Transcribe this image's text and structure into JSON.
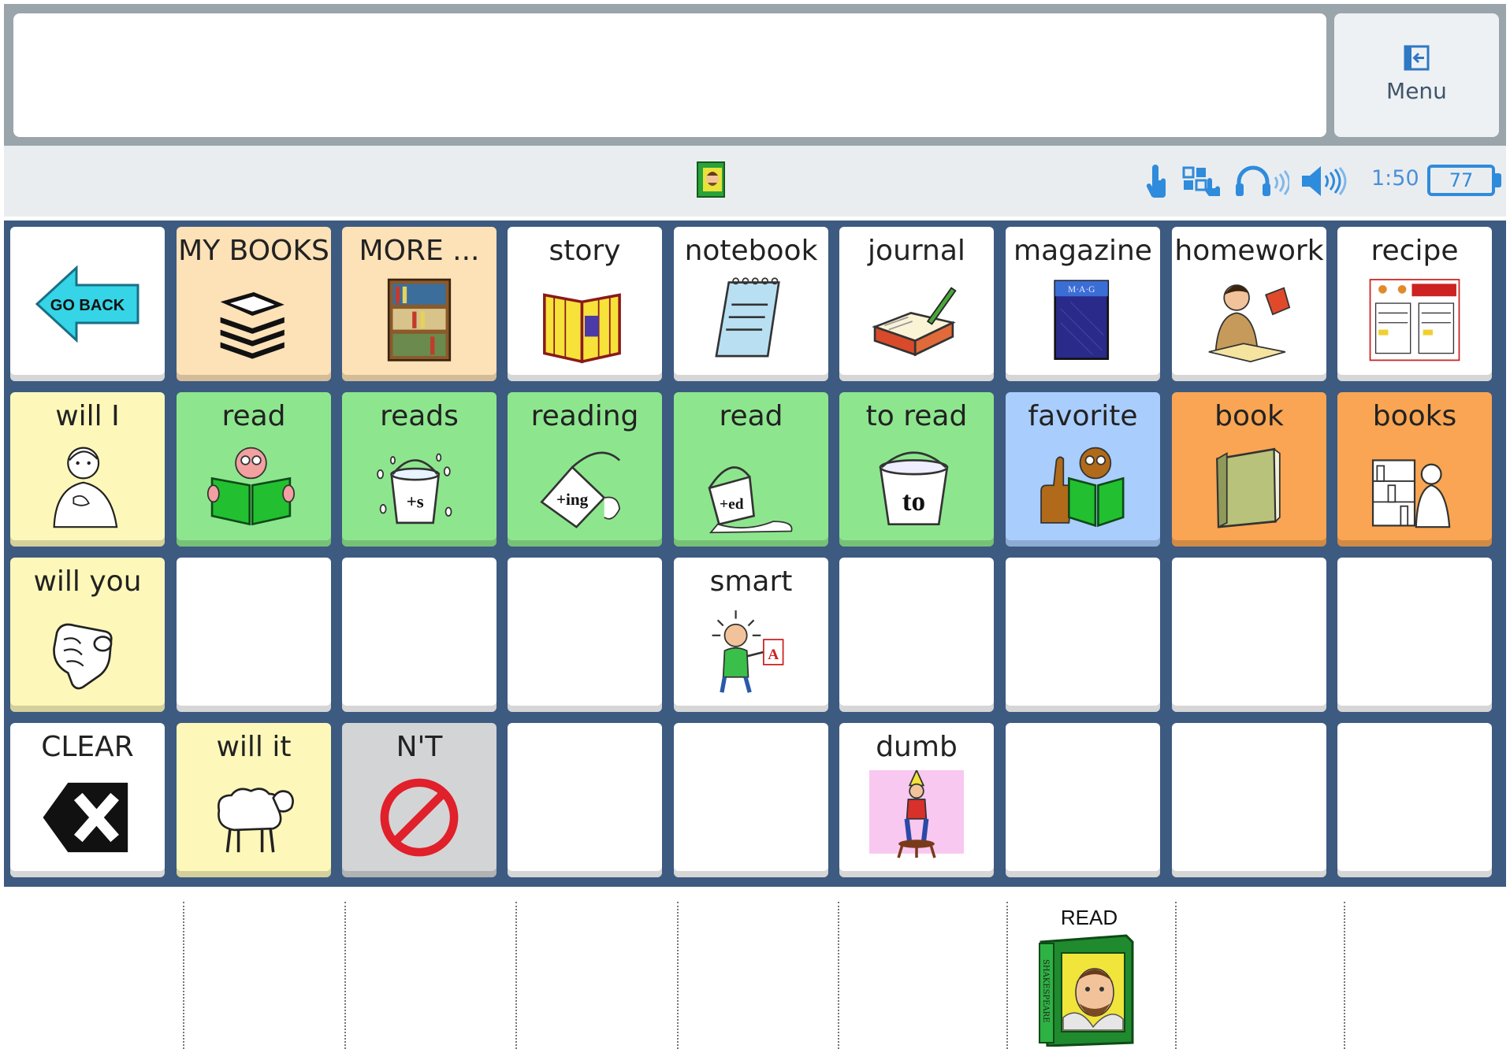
{
  "menu": {
    "label": "Menu",
    "icon": "exit-menu-icon"
  },
  "status": {
    "current_page_icon": "shakespeare-book-icon",
    "icons": [
      "touch-hand-icon",
      "grid-select-icon",
      "headphones-icon",
      "speaker-icon"
    ],
    "time": "1:50",
    "battery": "77"
  },
  "grid": [
    [
      {
        "label": "",
        "color": "#ffffff",
        "icon": "go-back-arrow-icon",
        "icon_text": "GO BACK"
      },
      {
        "label": "MY BOOKS",
        "color": "#fde1b7",
        "icon": "book-stack-icon"
      },
      {
        "label": "MORE ...",
        "color": "#fde1b7",
        "icon": "bookshelf-icon"
      },
      {
        "label": "story",
        "color": "#ffffff",
        "icon": "open-storybook-icon"
      },
      {
        "label": "notebook",
        "color": "#ffffff",
        "icon": "notebook-icon"
      },
      {
        "label": "journal",
        "color": "#ffffff",
        "icon": "journal-pen-icon"
      },
      {
        "label": "magazine",
        "color": "#ffffff",
        "icon": "magazine-icon",
        "icon_text": "M·A·G"
      },
      {
        "label": "homework",
        "color": "#ffffff",
        "icon": "homework-icon"
      },
      {
        "label": "recipe",
        "color": "#ffffff",
        "icon": "recipe-card-icon"
      }
    ],
    [
      {
        "label": "will I",
        "color": "#fdf8b9",
        "icon": "child-self-icon"
      },
      {
        "label": "read",
        "color": "#8de68e",
        "icon": "person-reading-icon"
      },
      {
        "label": "reads",
        "color": "#8de68e",
        "icon": "bucket-plus-s-icon",
        "icon_text": "+s"
      },
      {
        "label": "reading",
        "color": "#8de68e",
        "icon": "bucket-plus-ing-icon",
        "icon_text": "+ing"
      },
      {
        "label": "read",
        "color": "#8de68e",
        "icon": "bucket-plus-ed-icon",
        "icon_text": "+ed"
      },
      {
        "label": "to read",
        "color": "#8de68e",
        "icon": "bucket-to-icon",
        "icon_text": "to"
      },
      {
        "label": "favorite",
        "color": "#a9cdfc",
        "icon": "thumbs-up-reader-icon"
      },
      {
        "label": "book",
        "color": "#f9a553",
        "icon": "closed-book-icon"
      },
      {
        "label": "books",
        "color": "#f9a553",
        "icon": "library-shelf-icon"
      }
    ],
    [
      {
        "label": "will you",
        "color": "#fdf8b9",
        "icon": "pointing-hand-icon"
      },
      {
        "label": "",
        "color": "#ffffff",
        "icon": ""
      },
      {
        "label": "",
        "color": "#ffffff",
        "icon": ""
      },
      {
        "label": "",
        "color": "#ffffff",
        "icon": ""
      },
      {
        "label": "smart",
        "color": "#ffffff",
        "icon": "smart-student-icon",
        "icon_text": "A"
      },
      {
        "label": "",
        "color": "#ffffff",
        "icon": ""
      },
      {
        "label": "",
        "color": "#ffffff",
        "icon": ""
      },
      {
        "label": "",
        "color": "#ffffff",
        "icon": ""
      },
      {
        "label": "",
        "color": "#ffffff",
        "icon": ""
      }
    ],
    [
      {
        "label": "CLEAR",
        "color": "#ffffff",
        "icon": "clear-backspace-icon"
      },
      {
        "label": "will it",
        "color": "#fdf8b9",
        "icon": "sheep-icon"
      },
      {
        "label": "N'T",
        "color": "#d3d4d6",
        "icon": "prohibited-icon"
      },
      {
        "label": "",
        "color": "#ffffff",
        "icon": ""
      },
      {
        "label": "",
        "color": "#ffffff",
        "icon": ""
      },
      {
        "label": "dumb",
        "color": "#ffffff",
        "icon": "dunce-cap-icon"
      },
      {
        "label": "",
        "color": "#ffffff",
        "icon": ""
      },
      {
        "label": "",
        "color": "#ffffff",
        "icon": ""
      },
      {
        "label": "",
        "color": "#ffffff",
        "icon": ""
      }
    ]
  ],
  "bottom": {
    "label": "READ",
    "icon": "shakespeare-book-icon",
    "spine_text": "SHAKESPEARE"
  }
}
